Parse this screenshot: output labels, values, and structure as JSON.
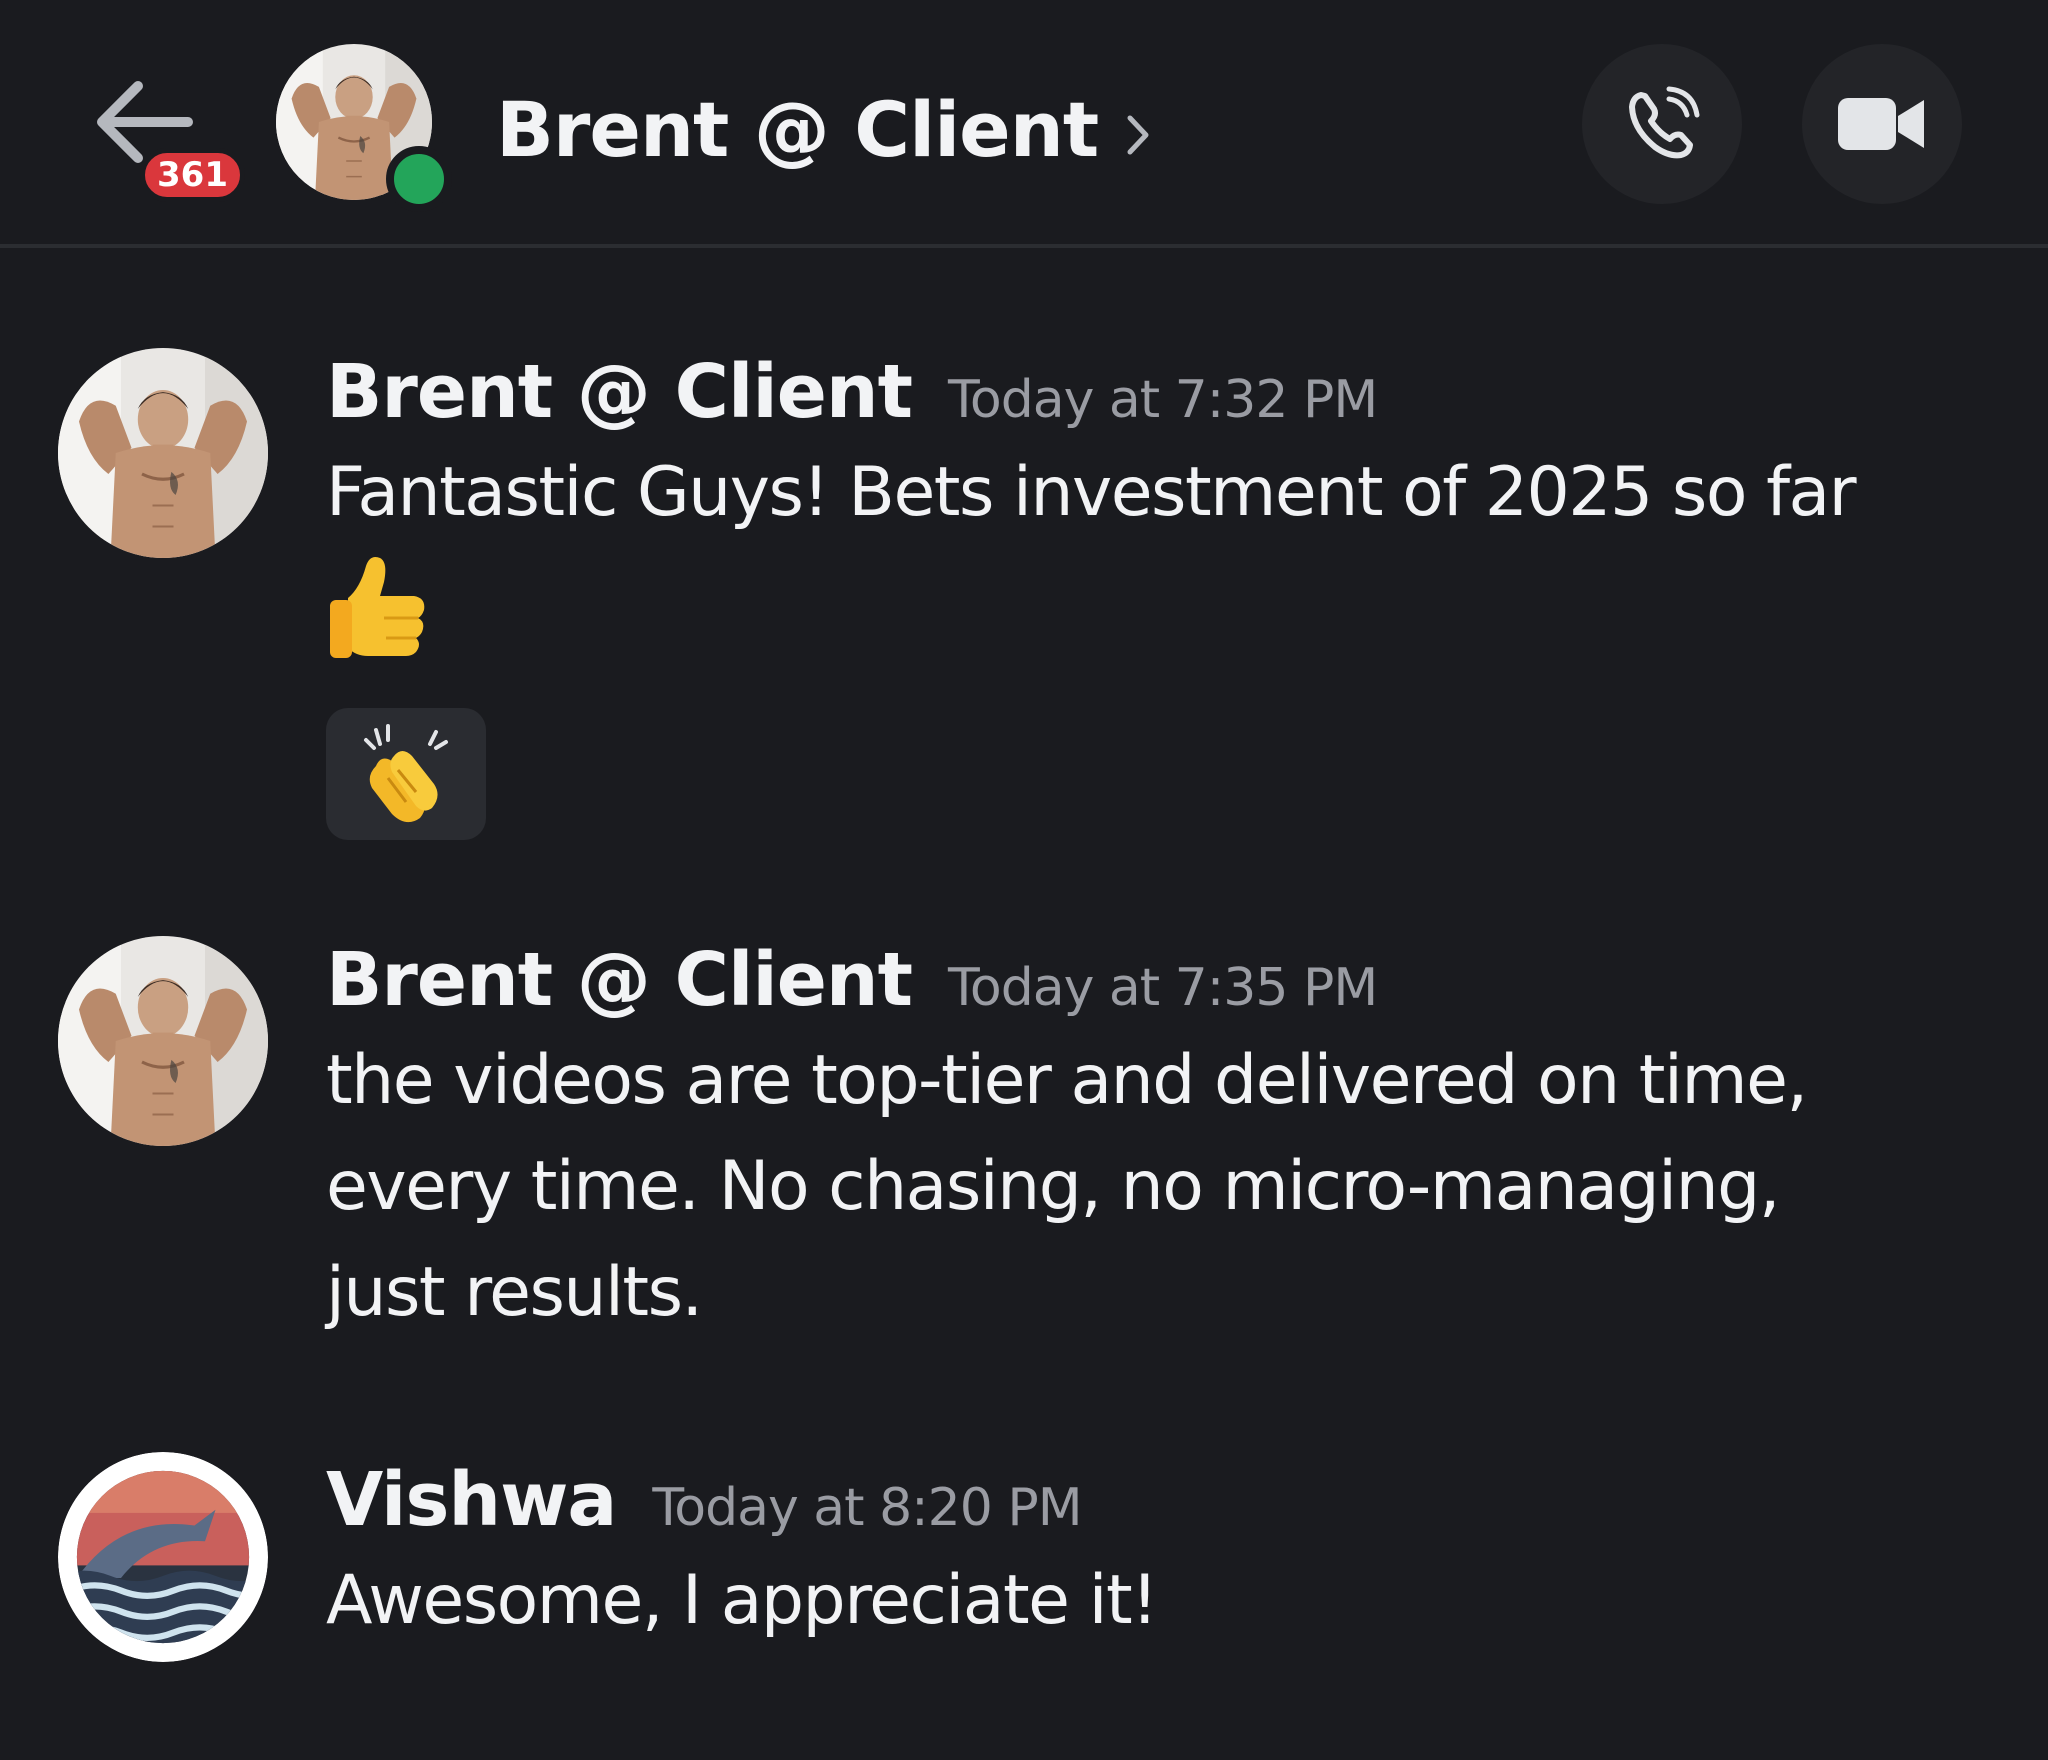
{
  "header": {
    "back_label": "Back",
    "unread_count": "361",
    "title": "Brent @ Client",
    "presence": "online",
    "call_icon": "phone-call-icon",
    "video_icon": "video-camera-icon"
  },
  "messages": [
    {
      "author": "Brent @ Client",
      "timestamp": "Today at 7:32 PM",
      "text": "Fantastic Guys! Bets investment of 2025 so far",
      "emoji": "thumbs-up",
      "reaction": "clapping-hands"
    },
    {
      "author": "Brent @ Client",
      "timestamp": "Today at 7:35 PM",
      "text": "the videos are top-tier and delivered on time,\nevery time. No chasing, no micro-managing,\njust results."
    },
    {
      "author": "Vishwa",
      "timestamp": "Today at 8:20 PM",
      "text": "Awesome, I appreciate it!"
    }
  ],
  "colors": {
    "background": "#1a1b1f",
    "text": "#f2f3f5",
    "muted": "#9a9ca3",
    "badge": "#da373c",
    "online": "#23a55a"
  }
}
